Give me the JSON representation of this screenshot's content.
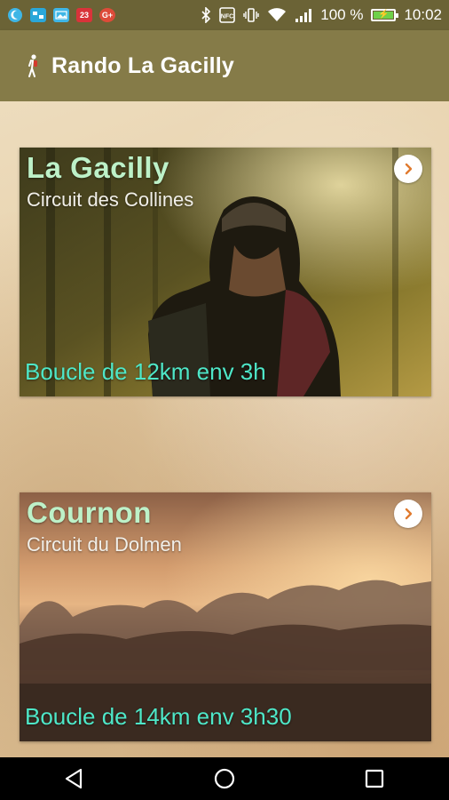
{
  "status_bar": {
    "notifications": [
      {
        "icon": "moon-notification-icon",
        "color": "#3fb6e6"
      },
      {
        "icon": "chat-notification-icon",
        "color": "#2aa7d9"
      },
      {
        "icon": "photo-notification-icon",
        "color": "#3fb6e6"
      },
      {
        "icon": "calendar-notification-icon",
        "color": "#d9333a",
        "label": "23"
      },
      {
        "icon": "google-plus-notification-icon",
        "color": "#dd4b39",
        "label": "G+"
      }
    ],
    "battery_percent_text": "100 %",
    "time": "10:02",
    "battery_level": 1.0
  },
  "app_bar": {
    "title": "Rando La Gacilly",
    "icon": "hiker-icon"
  },
  "routes": [
    {
      "name": "La Gacilly",
      "circuit": "Circuit des Collines",
      "info": "Boucle de 12km env 3h",
      "image": "forest-hiker-photo"
    },
    {
      "name": "Cournon",
      "circuit": "Circuit du Dolmen",
      "info": "Boucle de 14km env 3h30",
      "image": "misty-sunset-field-photo"
    }
  ],
  "colors": {
    "status_bar": "#6b6336",
    "app_bar": "#857b48",
    "route_name": "#bdf1c8",
    "route_info": "#4ee7c8",
    "arrow": "#e07a2e"
  },
  "nav_bar": {
    "icons": [
      "back-icon",
      "home-icon",
      "recents-icon"
    ]
  }
}
